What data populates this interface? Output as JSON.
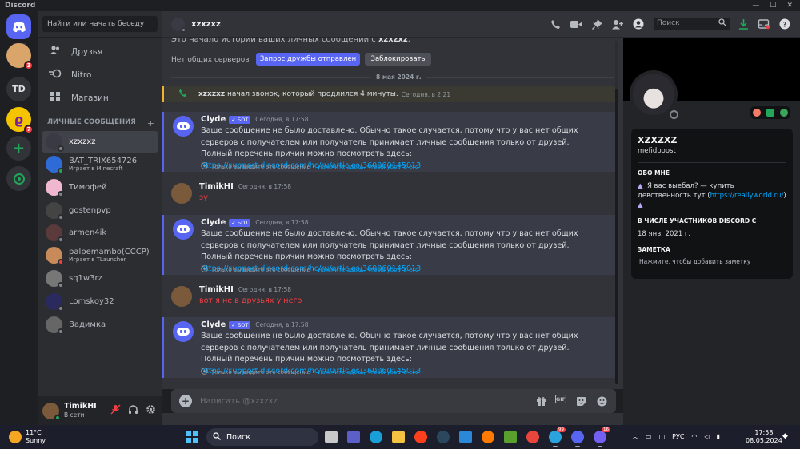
{
  "window": {
    "app_title": "Discord",
    "controls": [
      "—",
      "☐",
      "✕"
    ]
  },
  "guilds": [
    {
      "icon": "discord-home-icon",
      "badge": ""
    },
    {
      "icon": "server-avatar-icon",
      "badge": "3"
    },
    {
      "icon": "server-td-icon",
      "label": "TD",
      "badge": ""
    },
    {
      "icon": "server-r-icon",
      "badge": "7"
    },
    {
      "icon": "add-server-icon",
      "label": "+",
      "badge": ""
    },
    {
      "icon": "explore-icon",
      "badge": ""
    }
  ],
  "sidebar": {
    "search_placeholder": "Найти или начать беседу",
    "nav": [
      {
        "label": "Друзья",
        "icon": "friends-icon"
      },
      {
        "label": "Nitro",
        "icon": "nitro-icon"
      },
      {
        "label": "Магазин",
        "icon": "shop-icon"
      }
    ],
    "dm_header": "ЛИЧНЫЕ СООБЩЕНИЯ",
    "dm_add": "+",
    "dms": [
      {
        "name": "xzxzxz",
        "sub": "",
        "color": "#3a3a44",
        "status": "offline",
        "active": true
      },
      {
        "name": "BAT_TRIX654726",
        "sub": "Играет в Minecraft",
        "color": "#2f6bd6",
        "status": "online",
        "active": false
      },
      {
        "name": "Тимофей",
        "sub": "",
        "color": "#f0b8d0",
        "status": "offline",
        "active": false
      },
      {
        "name": "gostenpvp",
        "sub": "",
        "color": "#444",
        "status": "offline",
        "active": false
      },
      {
        "name": "armen4ik",
        "sub": "",
        "color": "#5a3a3a",
        "status": "offline",
        "active": false
      },
      {
        "name": "palpemambo(CCCP)",
        "sub": "Играет в TLauncher",
        "color": "#c98a5a",
        "status": "dnd",
        "active": false
      },
      {
        "name": "sq1w3rz",
        "sub": "",
        "color": "#777",
        "status": "offline",
        "active": false
      },
      {
        "name": "Lomskoy32",
        "sub": "",
        "color": "#2a2a5e",
        "status": "offline",
        "active": false
      },
      {
        "name": "Вадимка",
        "sub": "",
        "color": "#666",
        "status": "offline",
        "active": false
      }
    ]
  },
  "user": {
    "name": "TimikHI",
    "status": "В сети",
    "controls": [
      "mic-muted-icon",
      "headphones-icon",
      "settings-icon"
    ]
  },
  "header": {
    "channel": "xzxzxz",
    "search_placeholder": "Поиск",
    "tools": [
      "call-icon",
      "video-icon",
      "pin-icon",
      "add-friend-icon",
      "profile-toggle-icon"
    ],
    "tools_right": [
      "download-icon",
      "inbox-icon",
      "help-icon"
    ]
  },
  "chat": {
    "intro": "Это начало истории ваших личных сообщений с",
    "intro_name": "xzxzxz",
    "intro_tail": ".",
    "mutual": "Нет общих серверов",
    "friend_btn": "Запрос дружбы отправлен",
    "block_btn": "Заблокировать",
    "date_sep": "8 мая 2024 г.",
    "call": {
      "user": "xzxzxz",
      "text": "начал звонок, который продлился 4 минуты.",
      "time": "Сегодня, в 2:21"
    },
    "messages": [
      {
        "author": "Clyde",
        "bot": "✓ БОТ",
        "time": "Сегодня, в 17:58",
        "text": "Ваше сообщение не было доставлено. Обычно такое случается, потому что у вас нет общих серверов с получателем или получатель принимает личные сообщения только от друзей. Полный перечень причин можно посмотреть здесь:",
        "link": "https://support.discord.com/hc/ru/articles/360060145013",
        "note": "Только вы видите это сообщение •",
        "note_link": "Нажмите здесь, чтобы убрать его"
      },
      {
        "author": "TimikHI",
        "time": "Сегодня, в 17:58",
        "text": "эу"
      },
      {
        "author": "Clyde",
        "bot": "✓ БОТ",
        "time": "Сегодня, в 17:58",
        "text": "Ваше сообщение не было доставлено. Обычно такое случается, потому что у вас нет общих серверов с получателем или получатель принимает личные сообщения только от друзей. Полный перечень причин можно посмотреть здесь:",
        "link": "https://support.discord.com/hc/ru/articles/360060145013",
        "note": "Только вы видите это сообщение •",
        "note_link": "Нажмите здесь, чтобы убрать его"
      },
      {
        "author": "TimikHI",
        "time": "Сегодня, в 17:58",
        "text": "вот я не в друзьях у него"
      },
      {
        "author": "Clyde",
        "bot": "✓ БОТ",
        "time": "Сегодня, в 17:58",
        "text": "Ваше сообщение не было доставлено. Обычно такое случается, потому что у вас нет общих серверов с получателем или получатель принимает личные сообщения только от друзей. Полный перечень причин можно посмотреть здесь:",
        "link": "https://support.discord.com/hc/ru/articles/360060145013",
        "note": "Только вы видите это сообщение •",
        "note_link": "Нажмите здесь, чтобы убрать его"
      }
    ],
    "composer_placeholder": "Написать @xzxzxz",
    "composer_tools": [
      "gift-icon",
      "gif-icon",
      "sticker-icon",
      "emoji-icon"
    ],
    "gif_label": "GIF"
  },
  "profile": {
    "display_name": "XZXZXZ",
    "username": "mefidboost",
    "about_header": "ОБО МНЕ",
    "about_text": "Я вас выебал? — купить девственность тут (",
    "about_link": "https://reallyworld.ru/",
    "about_tail": ")",
    "member_header": "В ЧИСЛЕ УЧАСТНИКОВ DISCORD С",
    "member_since": "18 янв. 2021 г.",
    "note_header": "ЗАМЕТКА",
    "note_placeholder": "Нажмите, чтобы добавить заметку",
    "badges": [
      "#f47b67",
      "#23a55a",
      "#3ba55c"
    ]
  },
  "taskbar": {
    "temp": "11°C",
    "weather": "Sunny",
    "search": "Поиск",
    "lang": "РУС",
    "time": "17:58",
    "date": "08.05.2024",
    "apps": [
      {
        "icon": "file-explorer-icon",
        "color": "#c9c9c9",
        "count": ""
      },
      {
        "icon": "teams-icon",
        "color": "#5b5fc7",
        "count": ""
      },
      {
        "icon": "edge-icon",
        "color": "#1aa0d8",
        "count": ""
      },
      {
        "icon": "folder-icon",
        "color": "#f5c242",
        "count": ""
      },
      {
        "icon": "yandex-icon",
        "color": "#fc3f1d",
        "count": ""
      },
      {
        "icon": "steam-icon",
        "color": "#2a475e",
        "count": ""
      },
      {
        "icon": "app-blue-icon",
        "color": "#2b88d8",
        "count": ""
      },
      {
        "icon": "app-orange-icon",
        "color": "#ff7a00",
        "count": ""
      },
      {
        "icon": "minecraft-icon",
        "color": "#5aa02c",
        "count": ""
      },
      {
        "icon": "chrome-icon",
        "color": "#e8453c",
        "count": ""
      },
      {
        "icon": "telegram-icon",
        "color": "#2aa3df",
        "count": "99"
      },
      {
        "icon": "discord-icon",
        "color": "#5865f2",
        "count": ""
      },
      {
        "icon": "viber-icon",
        "color": "#7360f2",
        "count": "16"
      }
    ]
  }
}
